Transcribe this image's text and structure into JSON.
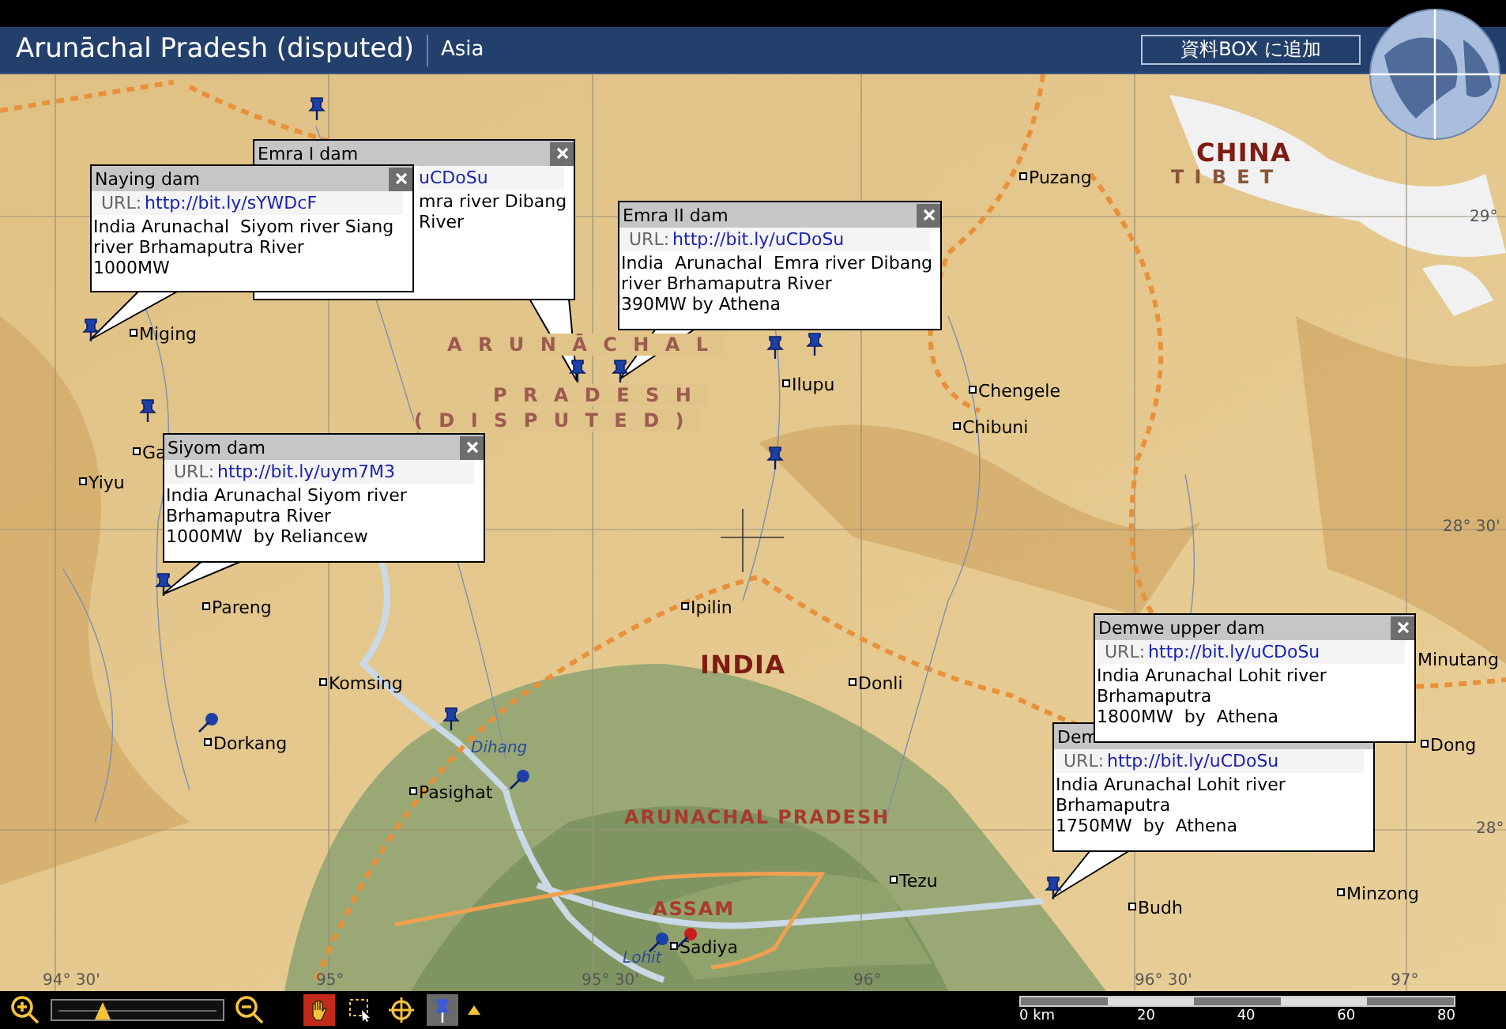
{
  "header": {
    "title": "Arunāchal Pradesh (disputed)",
    "region": "Asia",
    "add_button": "資料BOX に追加"
  },
  "map": {
    "places": [
      {
        "name": "Miging"
      },
      {
        "name": "Puzang"
      },
      {
        "name": "Ilupu"
      },
      {
        "name": "Chengele"
      },
      {
        "name": "Chibuni"
      },
      {
        "name": "Yiyu"
      },
      {
        "name": "Ga"
      },
      {
        "name": "Pareng"
      },
      {
        "name": "Ipilin"
      },
      {
        "name": "Komsing"
      },
      {
        "name": "Dorkang"
      },
      {
        "name": "Pasighat"
      },
      {
        "name": "Donli"
      },
      {
        "name": "Minutang"
      },
      {
        "name": "Dong"
      },
      {
        "name": "Tezu"
      },
      {
        "name": "Budh"
      },
      {
        "name": "Minzong"
      },
      {
        "name": "Sadiya"
      }
    ],
    "regions": [
      {
        "name": "CHINA",
        "kind": "country"
      },
      {
        "name": "TIBET",
        "kind": "area"
      },
      {
        "name": "ARUNĀCHAL",
        "kind": "disputed"
      },
      {
        "name": "PRADESH",
        "kind": "disputed"
      },
      {
        "name": "(DISPUTED)",
        "kind": "disputed"
      },
      {
        "name": "INDIA",
        "kind": "country"
      },
      {
        "name": "ARUNACHAL PRADESH",
        "kind": "state"
      },
      {
        "name": "ASSAM",
        "kind": "state"
      }
    ],
    "rivers": [
      {
        "name": "Dihang"
      },
      {
        "name": "Lohit"
      }
    ],
    "coordinates": [
      "29°",
      "28° 30'",
      "28°",
      "94° 30'",
      "95°",
      "95° 30'",
      "96°",
      "96° 30'",
      "97°"
    ]
  },
  "callouts": [
    {
      "title": "Emra I dam",
      "url": "uCDoSu",
      "lines": [
        "mra river Dibang",
        "River"
      ]
    },
    {
      "title": "Naying dam",
      "url_label": "URL:",
      "url": "http://bit.ly/sYWDcF",
      "lines": [
        "India Arunachal  Siyom river Siang",
        "river Brhamaputra River",
        "1000MW"
      ]
    },
    {
      "title": "Emra II dam",
      "url_label": "URL:",
      "url": "http://bit.ly/uCDoSu",
      "lines": [
        "India  Arunachal  Emra river Dibang",
        "river Brhamaputra River",
        "390MW by Athena"
      ]
    },
    {
      "title": "Siyom dam",
      "url_label": "URL:",
      "url": "http://bit.ly/uym7M3",
      "lines": [
        "India Arunachal Siyom river",
        "Brhamaputra River",
        "1000MW  by Reliancew"
      ]
    },
    {
      "title": "Demwe upper dam",
      "url_label": "URL:",
      "url": "http://bit.ly/uCDoSu",
      "lines": [
        "India Arunachal Lohit river",
        "Brhamaputra",
        "1800MW  by  Athena"
      ]
    },
    {
      "title": "Dem",
      "url_label": "URL:",
      "url": "http://bit.ly/uCDoSu",
      "lines": [
        "India Arunachal Lohit river",
        "Brhamaputra",
        "1750MW  by  Athena"
      ]
    }
  ],
  "toolbar": {
    "zoom": {
      "level": 0.3
    },
    "tools": [
      {
        "kind": "hand",
        "selected": true
      },
      {
        "kind": "select",
        "selected": false
      },
      {
        "kind": "target",
        "selected": false
      },
      {
        "kind": "pin",
        "selected": true
      }
    ],
    "scale": [
      "0 km",
      "20",
      "40",
      "60",
      "80"
    ]
  }
}
